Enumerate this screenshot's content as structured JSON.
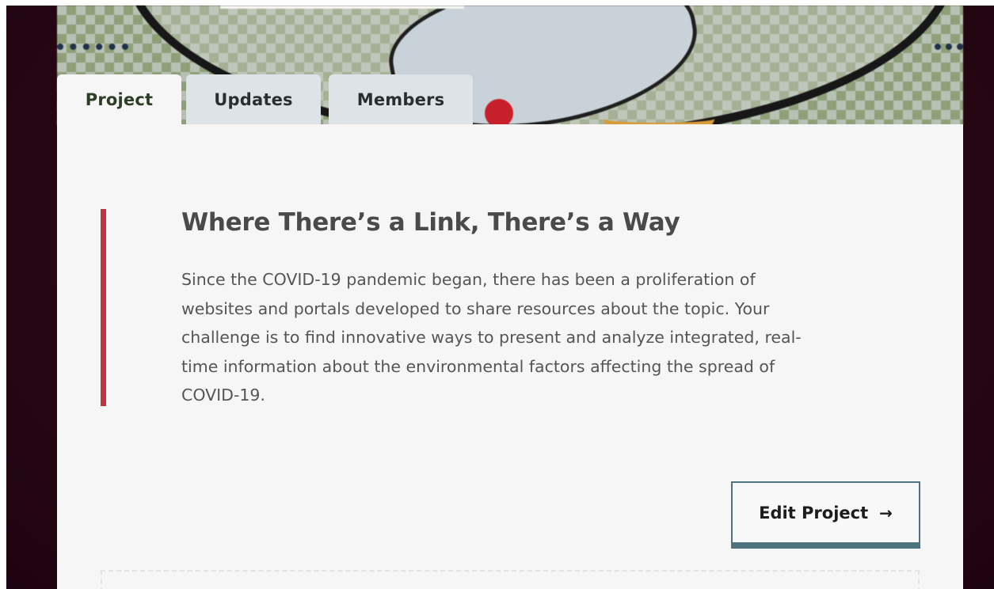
{
  "tabs": [
    {
      "label": "Project",
      "active": true
    },
    {
      "label": "Updates",
      "active": false
    },
    {
      "label": "Members",
      "active": false
    }
  ],
  "project": {
    "title": "Where There’s a Link, There’s a Way",
    "description": "Since the COVID-19 pandemic began, there has been a proliferation of websites and portals developed to share resources about the topic. Your challenge is to find innovative ways to present and analyze integrated, real-time information about the environmental factors affecting the spread of COVID-19."
  },
  "actions": {
    "edit_label": "Edit Project",
    "edit_arrow": "→"
  },
  "colors": {
    "accent_red": "#c2353f",
    "button_border": "#4e7480",
    "panel_bg": "#f6f6f6",
    "inactive_tab_bg": "#dde3e6",
    "page_backdrop": "#2a0714"
  }
}
